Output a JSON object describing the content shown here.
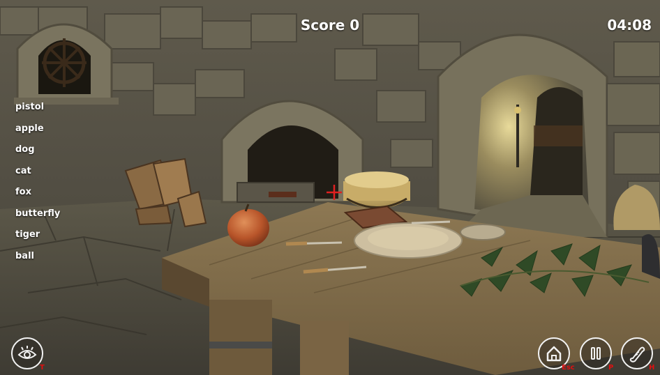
{
  "hud": {
    "score_label": "Score 0",
    "timer": "04:08"
  },
  "items": [
    "pistol",
    "apple",
    "dog",
    "cat",
    "fox",
    "butterfly",
    "tiger",
    "ball"
  ],
  "buttons": {
    "hint": {
      "icon": "eye-icon",
      "hotkey": "T"
    },
    "home": {
      "icon": "home-icon",
      "hotkey": "Esc"
    },
    "pause": {
      "icon": "pause-icon",
      "hotkey": "P"
    },
    "help": {
      "icon": "scroll-icon",
      "hotkey": "H"
    }
  },
  "colors": {
    "hud_text": "#ffffff",
    "hotkey": "#e01010",
    "crosshair": "#e02020"
  }
}
